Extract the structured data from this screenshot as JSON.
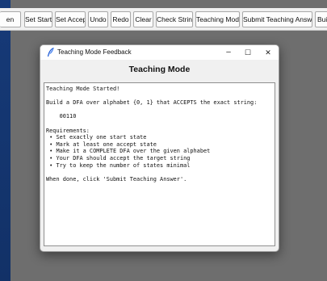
{
  "toolbar": {
    "buttons": [
      {
        "label": "en"
      },
      {
        "label": "Set Start"
      },
      {
        "label": "Set Accept"
      },
      {
        "label": "Undo"
      },
      {
        "label": "Redo"
      },
      {
        "label": "Clear"
      },
      {
        "label": "Check String"
      },
      {
        "label": "Teaching Mode"
      },
      {
        "label": "Submit Teaching Answer"
      },
      {
        "label": "Bui"
      }
    ]
  },
  "dialog": {
    "title": "Teaching Mode Feedback",
    "controls": {
      "minimize": "–",
      "maximize": "☐",
      "close": "✕"
    },
    "heading": "Teaching Mode",
    "text": {
      "l1": "Teaching Mode Started!",
      "l2": "Build a DFA over alphabet {0, 1} that ACCEPTS the exact string:",
      "l3": "    00110",
      "l4": "Requirements:",
      "l5": " • Set exactly one start state",
      "l6": " • Mark at least one accept state",
      "l7": " • Make it a COMPLETE DFA over the given alphabet",
      "l8": " • Your DFA should accept the target string",
      "l9": " • Try to keep the number of states minimal",
      "l10": "When done, click 'Submit Teaching Answer'."
    }
  },
  "colors": {
    "desktop": "#1a3c72",
    "app_background": "#6e6e6e",
    "dialog_background": "#f0f0f0"
  }
}
